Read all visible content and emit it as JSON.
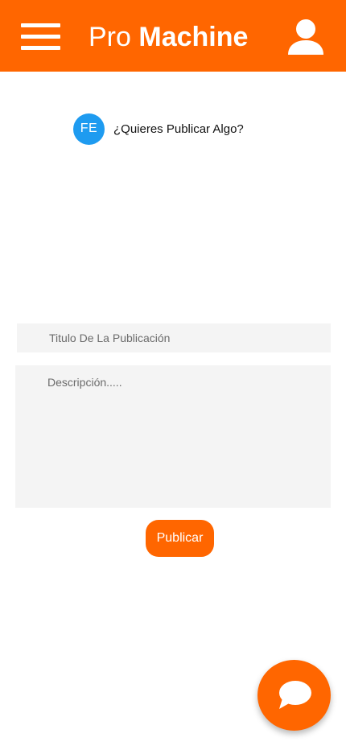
{
  "header": {
    "brand_light": "Pro",
    "brand_bold": "Machine",
    "icons": {
      "menu": "hamburger-menu-icon",
      "user": "user-icon"
    },
    "color": "#ff6600"
  },
  "post_prompt": {
    "avatar_initials": "FE",
    "avatar_color": "#1e9bf0",
    "text": "¿Quieres Publicar Algo?"
  },
  "form": {
    "title_placeholder": "Titulo De La Publicación",
    "title_value": "",
    "description_placeholder": "Descripción.....",
    "description_value": "",
    "publish_label": "Publicar"
  },
  "fab": {
    "icon": "chat-bubble-icon"
  }
}
